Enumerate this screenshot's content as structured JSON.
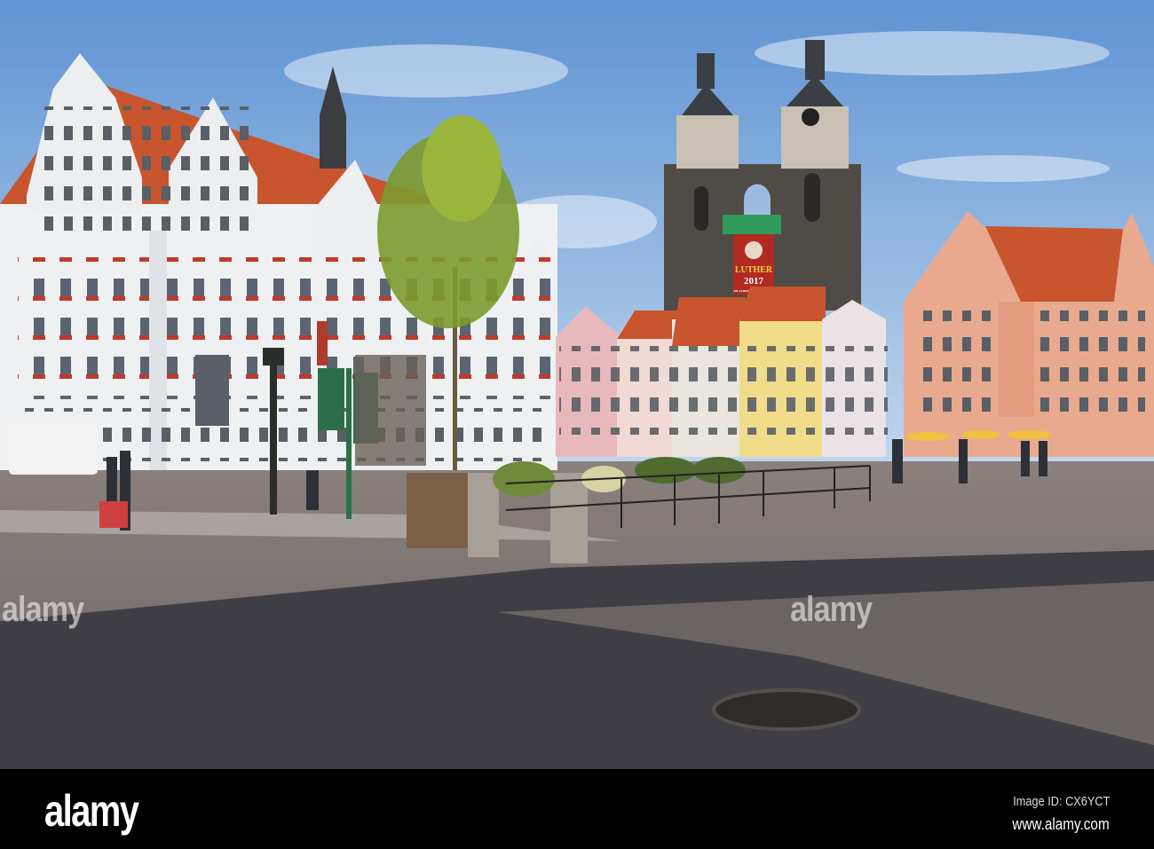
{
  "photo": {
    "banner": {
      "line1": "LUTHER",
      "line2": "2017",
      "line3": "500 JAHRE REFORMATION"
    },
    "colors": {
      "sky_top": "#6a9bd6",
      "sky_bottom": "#c9dcef",
      "roof": "#c8552e",
      "stone": "#4e4a44",
      "cobble": "#6e6a68",
      "shadow": "#3e3d42"
    }
  },
  "watermarks": [
    "alamy",
    "alamy"
  ],
  "footer": {
    "logo": "alamy",
    "image_id": "Image ID: CX6YCT",
    "url": "www.alamy.com"
  }
}
